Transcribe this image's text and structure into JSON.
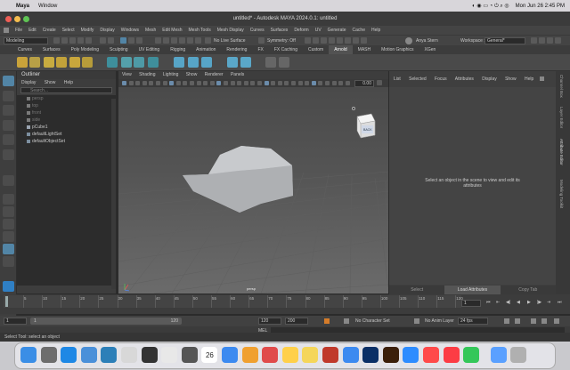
{
  "mac_menubar": {
    "app_name": "Maya",
    "items": [
      "Window"
    ],
    "clock": "Mon Jun 26  2:45 PM"
  },
  "window": {
    "title": "untitled* - Autodesk MAYA 2024.0.1: untitled"
  },
  "main_menu": [
    "File",
    "Edit",
    "Create",
    "Select",
    "Modify",
    "Display",
    "Windows",
    "Mesh",
    "Edit Mesh",
    "Mesh Tools",
    "Mesh Display",
    "Curves",
    "Surfaces",
    "Deform",
    "UV",
    "Generate",
    "Cache",
    "Help"
  ],
  "status_line": {
    "mode_menu": "Modeling",
    "live_surface": "No Live Surface",
    "symmetry": "Symmetry: Off",
    "user": "Anya Stern",
    "workspace_label": "Workspace :",
    "workspace_value": "General*"
  },
  "shelf_tabs": {
    "items": [
      "Curves",
      "Surfaces",
      "Poly Modeling",
      "Sculpting",
      "UV Editing",
      "Rigging",
      "Animation",
      "Rendering",
      "FX",
      "FX Caching",
      "Custom",
      "Arnold",
      "MASH",
      "Motion Graphics",
      "XGen"
    ],
    "active": "Arnold"
  },
  "outliner": {
    "title": "Outliner",
    "menu": [
      "Display",
      "Show",
      "Help"
    ],
    "search_placeholder": "Search...",
    "items": [
      {
        "label": "persp",
        "dim": true
      },
      {
        "label": "top",
        "dim": true
      },
      {
        "label": "front",
        "dim": true
      },
      {
        "label": "side",
        "dim": true
      },
      {
        "label": "pCube1",
        "dim": false
      },
      {
        "label": "defaultLightSet",
        "dim": false
      },
      {
        "label": "defaultObjectSet",
        "dim": false
      }
    ]
  },
  "viewport": {
    "menu": [
      "View",
      "Shading",
      "Lighting",
      "Show",
      "Renderer",
      "Panels"
    ],
    "value_field": "0.00",
    "camera_label": "persp",
    "viewcube_label": "BACK"
  },
  "attribute_editor": {
    "menu": [
      "List",
      "Selected",
      "Focus",
      "Attributes",
      "Display",
      "Show",
      "Help"
    ],
    "empty_message_line1": "Select an object in the scene to view and edit its",
    "empty_message_line2": "attributes",
    "bottom_tabs": [
      "Select",
      "Load Attributes",
      "Copy Tab"
    ],
    "active_tab": "Load Attributes"
  },
  "side_tabs": [
    "Channel Box",
    "Layer Editor",
    "Attribute Editor",
    "Modeling Toolkit"
  ],
  "time_slider": {
    "ticks": [
      "5",
      "10",
      "15",
      "20",
      "25",
      "30",
      "35",
      "40",
      "45",
      "50",
      "55",
      "60",
      "65",
      "70",
      "75",
      "80",
      "85",
      "90",
      "95",
      "100",
      "105",
      "110",
      "115",
      "120"
    ],
    "current_frame": "1"
  },
  "range_slider": {
    "start": "1",
    "inner_start": "1",
    "inner_end": "120",
    "end_a": "120",
    "end_b": "200",
    "character_set": "No Character Set",
    "anim_layer": "No Anim Layer",
    "fps": "24 fps"
  },
  "command_line": {
    "label": "MEL"
  },
  "help_line": {
    "text": "Select Tool: select an object"
  },
  "dock_icons": [
    "finder-icon",
    "launchpad-icon",
    "safari-icon",
    "mail-icon",
    "maya-icon",
    "preview-icon",
    "terminal-icon",
    "chrome-icon",
    "app-icon",
    "calendar-icon",
    "mail-app-icon",
    "photos-icon",
    "app-icon-2",
    "app-icon-3",
    "notes-icon",
    "acrobat-icon",
    "app-icon-4",
    "photoshop-icon",
    "illustrator-icon",
    "zoom-icon",
    "creative-cloud-icon",
    "music-icon",
    "facetime-icon",
    "downloads-icon",
    "trash-icon"
  ],
  "calendar_day": "26",
  "colors": {
    "accent_blue": "#5285a6",
    "active_tab": "#525252"
  }
}
